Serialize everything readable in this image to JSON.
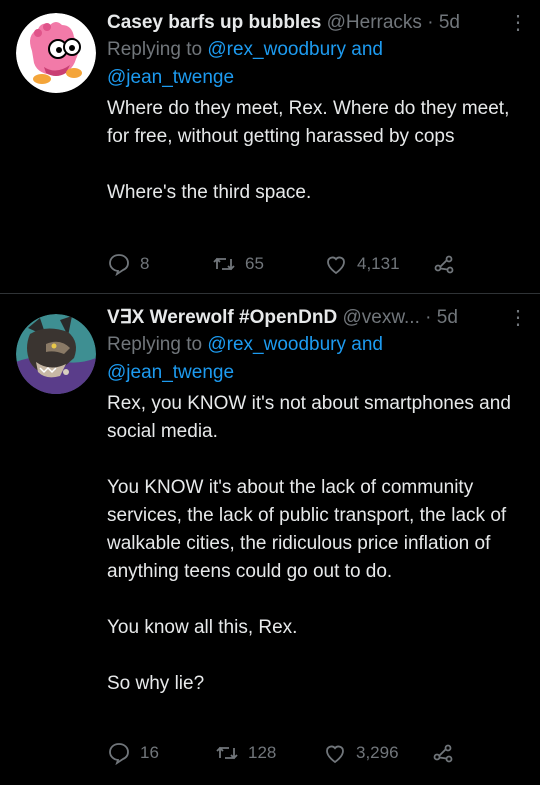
{
  "tweets": [
    {
      "name": "Casey barfs up bubbles",
      "handle": "@Herracks",
      "separator": "·",
      "time": "5d",
      "replying_prefix": "Replying to",
      "replying_line1": "@rex_woodbury and",
      "replying_line2": "@jean_twenge",
      "text": "Where do they meet, Rex. Where do they meet, for free, without getting harassed by cops\n\nWhere's the third space.",
      "replies": "8",
      "retweets": "65",
      "likes": "4,131"
    },
    {
      "name": "V∃X Werewolf #OpenDnD",
      "handle": "@vexw...",
      "separator": "·",
      "time": "5d",
      "replying_prefix": "Replying to",
      "replying_line1": "@rex_woodbury and",
      "replying_line2": "@jean_twenge",
      "text": "Rex, you KNOW it's not about smartphones and social media.\n\nYou KNOW it's about the lack of community services, the lack of public transport, the lack of walkable cities, the ridiculous price inflation of anything teens could go out to do.\n\nYou know all this, Rex.\n\nSo why lie?",
      "replies": "16",
      "retweets": "128",
      "likes": "3,296"
    }
  ],
  "colors": {
    "background": "#000000",
    "text": "#e7e9ea",
    "secondary": "#71767b",
    "link": "#1d9bf0",
    "divider": "#2f3336"
  },
  "icons": [
    "reply-icon",
    "retweet-icon",
    "like-icon",
    "share-icon",
    "more-icon"
  ]
}
